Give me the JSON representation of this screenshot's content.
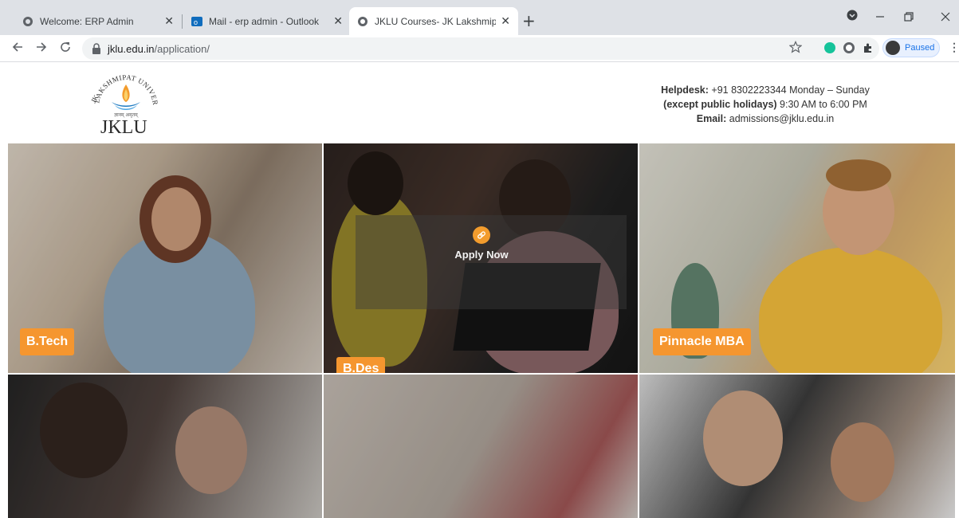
{
  "browser": {
    "tabs": [
      {
        "title": "Welcome: ERP Admin",
        "active": false,
        "icon": "globe-icon"
      },
      {
        "title": "Mail - erp admin - Outlook",
        "active": false,
        "icon": "outlook-icon"
      },
      {
        "title": "JKLU Courses- JK Lakshmipat Uni",
        "active": true,
        "icon": "globe-icon"
      }
    ],
    "new_tab": "+",
    "close_glyph": "✕",
    "url_domain": "jklu.edu.in",
    "url_path": "/application/",
    "profile_status": "Paused"
  },
  "header": {
    "logo_arc": "LAKSHMIPAT UNIVERSITY",
    "logo_left": "JK",
    "logo_hindi": "ज्ञानम् अमृतम्",
    "logo_text": "JKLU",
    "helpdesk_label": "Helpdesk:",
    "helpdesk_value": " +91 8302223344 Monday – Sunday",
    "except_label": "(except public holidays)",
    "except_value": " 9:30 AM to 6:00 PM",
    "email_label": "Email:",
    "email_value": " admissions@jklu.edu.in"
  },
  "courses": [
    {
      "label": "B.Tech"
    },
    {
      "label": "B.Des"
    },
    {
      "label": "Pinnacle MBA"
    }
  ],
  "overlay": {
    "apply_label": "Apply Now",
    "apply_icon": "link-icon"
  },
  "colors": {
    "accent": "#f5962f",
    "tab_bg": "#dee1e6"
  }
}
